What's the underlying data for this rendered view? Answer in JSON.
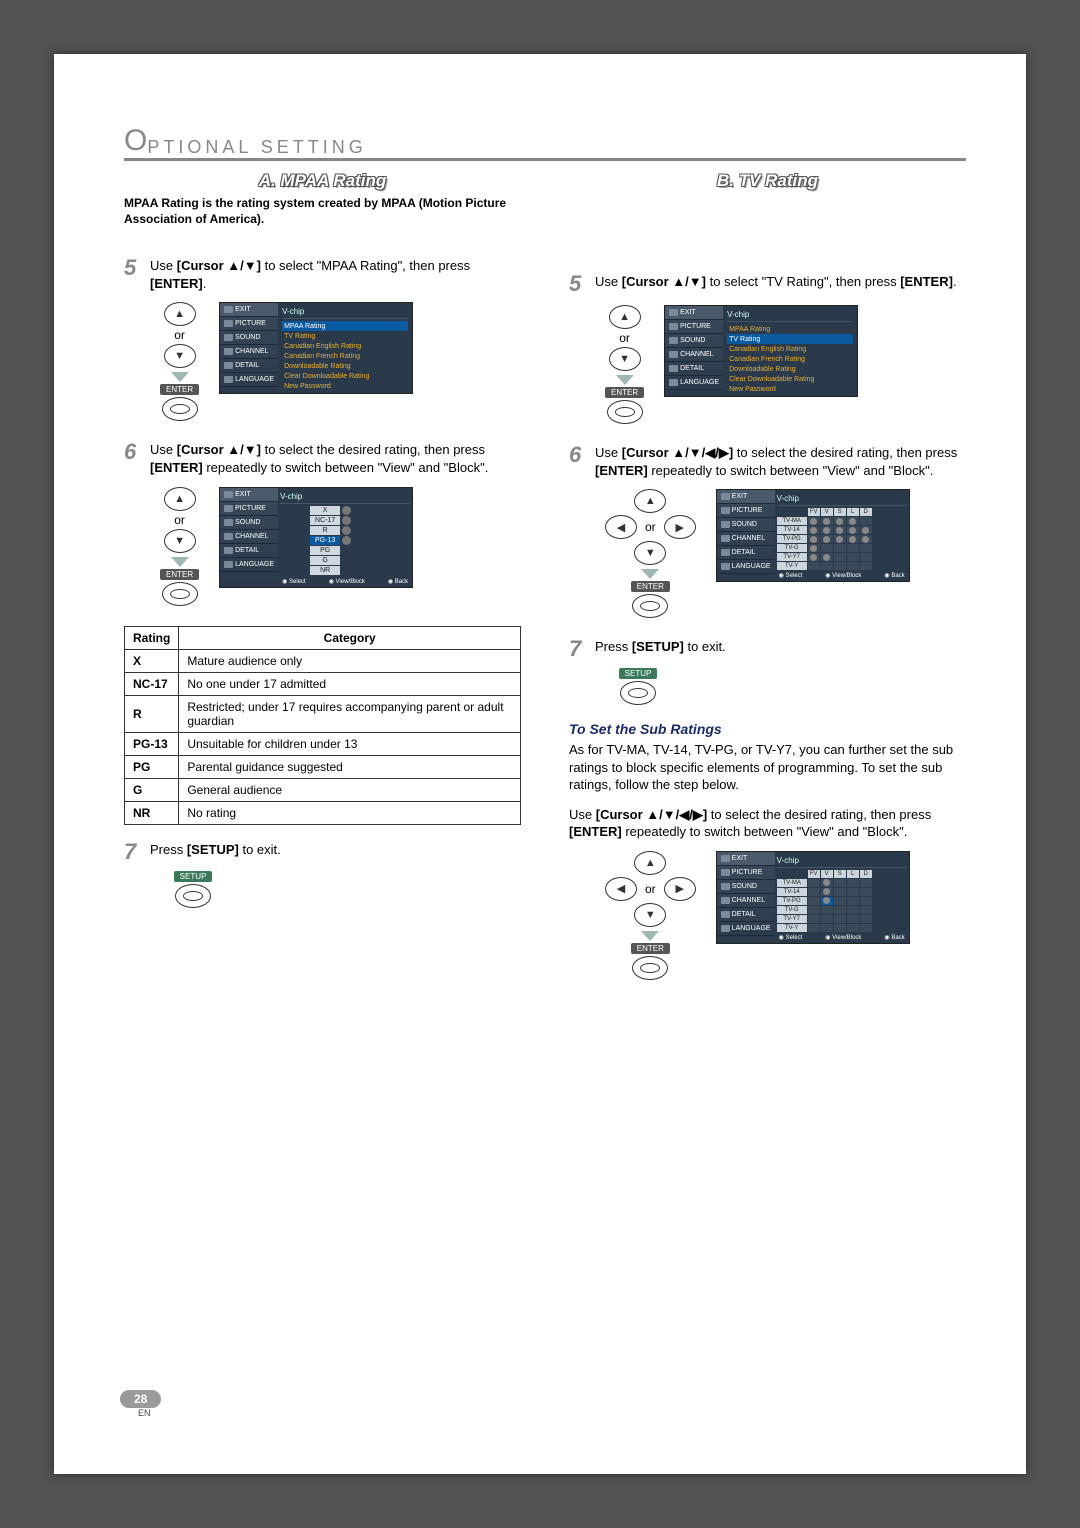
{
  "header": {
    "drop_cap_letter": "O",
    "rest": "PTIONAL SETTING"
  },
  "sectionA": {
    "title": "A. MPAA Rating",
    "intro": "MPAA Rating is the rating system created by MPAA (Motion Picture Association of America)."
  },
  "sectionB": {
    "title": "B. TV Rating"
  },
  "stepsA": {
    "s5_pre": "Use ",
    "s5_bold1": "[Cursor ▲/▼]",
    "s5_mid": " to select \"MPAA Rating\", then press ",
    "s5_bold2": "[ENTER]",
    "s5_end": ".",
    "s6_pre": "Use ",
    "s6_bold1": "[Cursor ▲/▼]",
    "s6_mid": " to select the desired rating, then press ",
    "s6_bold2": "[ENTER]",
    "s6_mid2": " repeatedly to switch between \"View\" and \"Block\".",
    "s7_pre": "Press ",
    "s7_bold": "[SETUP]",
    "s7_end": " to exit."
  },
  "stepsB": {
    "s5_pre": "Use ",
    "s5_bold1": "[Cursor ▲/▼]",
    "s5_mid": " to select \"TV Rating\", then press ",
    "s5_bold2": "[ENTER]",
    "s5_end": ".",
    "s6_pre": "Use ",
    "s6_bold1": "[Cursor ▲/▼/◀/▶]",
    "s6_mid": " to select the desired rating, then press ",
    "s6_bold2": "[ENTER]",
    "s6_mid2": " repeatedly to switch between \"View\" and \"Block\".",
    "s7_pre": "Press ",
    "s7_bold": "[SETUP]",
    "s7_end": " to exit."
  },
  "dpad": {
    "or": "or",
    "enter": "ENTER",
    "setup": "SETUP"
  },
  "menu_sidebar": [
    "EXIT",
    "PICTURE",
    "SOUND",
    "CHANNEL",
    "DETAIL",
    "LANGUAGE"
  ],
  "vchip_title": "V-chip",
  "vchip_items": [
    "MPAA Rating",
    "TV Rating",
    "Canadian English Rating",
    "Canadian French Rating",
    "Downloadable Rating",
    "Clear Downloadable Rating",
    "New Password"
  ],
  "mpaa_category_header": {
    "rating": "Rating",
    "category": "Category"
  },
  "mpaa_table": [
    {
      "r": "X",
      "c": "Mature audience only"
    },
    {
      "r": "NC-17",
      "c": "No one under 17 admitted"
    },
    {
      "r": "R",
      "c": "Restricted; under 17 requires accompanying parent or adult guardian"
    },
    {
      "r": "PG-13",
      "c": "Unsuitable for children under 13"
    },
    {
      "r": "PG",
      "c": "Parental guidance suggested"
    },
    {
      "r": "G",
      "c": "General audience"
    },
    {
      "r": "NR",
      "c": "No rating"
    }
  ],
  "mpaa_small_ratings": [
    "X",
    "NC-17",
    "R",
    "PG-13",
    "PG",
    "G",
    "NR"
  ],
  "tv_cols": [
    "FV",
    "V",
    "S",
    "L",
    "D"
  ],
  "tv_rows": [
    "TV-MA",
    "TV-14",
    "TV-PG",
    "TV-G",
    "TV-Y7",
    "TV-Y"
  ],
  "footer_hints": {
    "select": "Select",
    "viewblock": "View/Block",
    "back": "Back"
  },
  "sub_section": {
    "title": "To Set the Sub Ratings",
    "para": "As for TV-MA, TV-14, TV-PG, or TV-Y7, you can further set the sub ratings to block specific elements of programming. To set the sub ratings, follow the step below.",
    "instr_pre": "Use ",
    "instr_bold1": "[Cursor ▲/▼/◀/▶]",
    "instr_mid": " to select the desired rating, then press ",
    "instr_bold2": "[ENTER]",
    "instr_end": " repeatedly to switch between \"View\" and \"Block\"."
  },
  "page_num": "28",
  "page_lang": "EN"
}
